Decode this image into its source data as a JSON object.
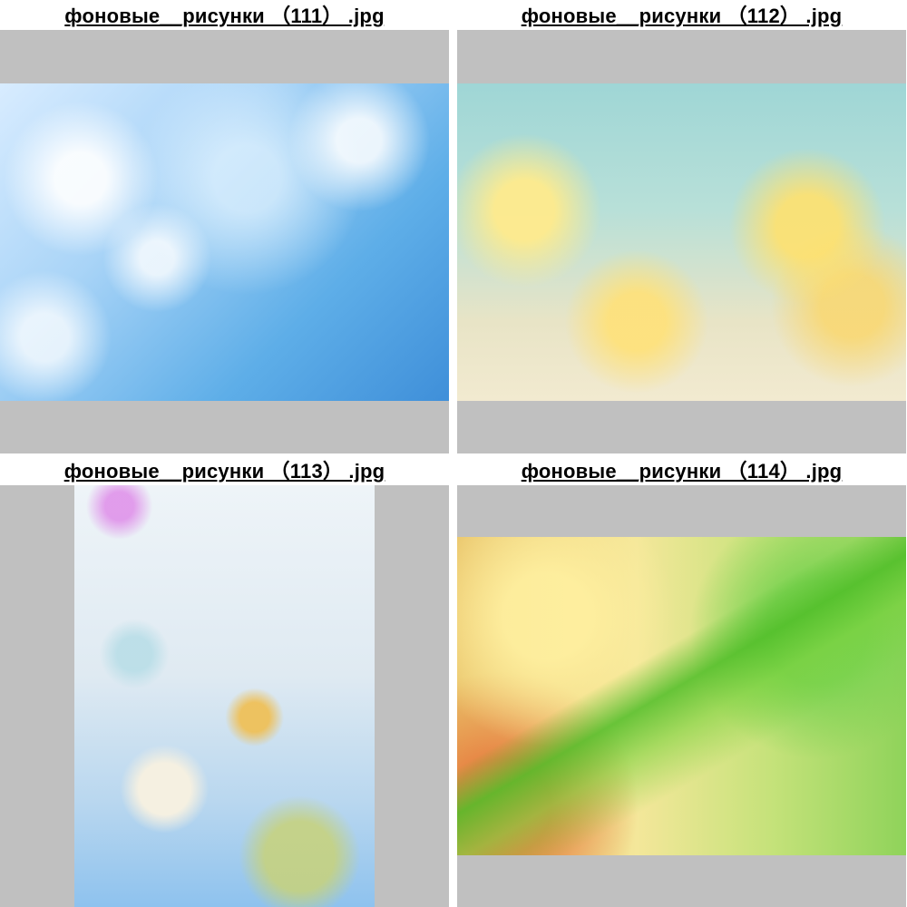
{
  "gallery": {
    "items": [
      {
        "caption": "фоновые__рисунки （111） .jpg"
      },
      {
        "caption": "фоновые__рисунки （112） .jpg"
      },
      {
        "caption": "фоновые__рисунки （113） .jpg"
      },
      {
        "caption": "фоновые__рисунки （114） .jpg"
      }
    ]
  }
}
